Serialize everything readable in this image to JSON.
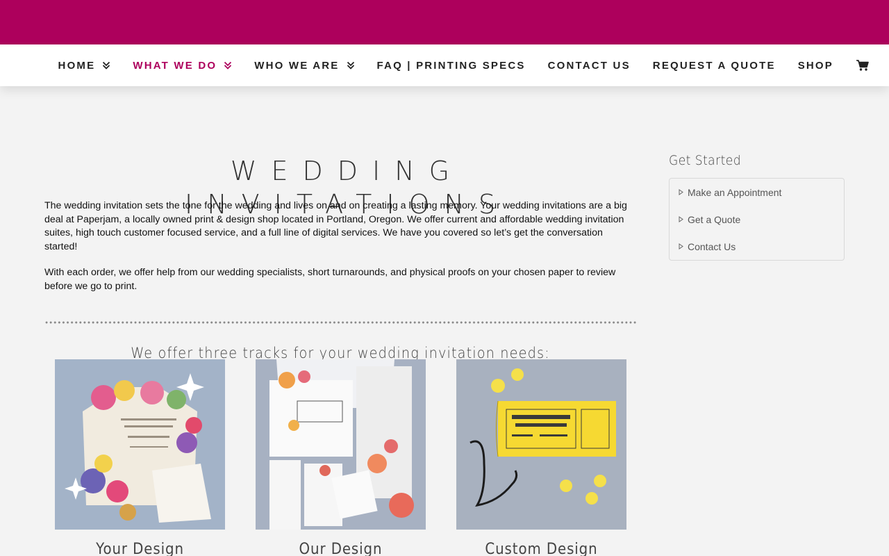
{
  "nav": {
    "items": [
      {
        "label": "HOME",
        "dropdown": true,
        "active": false
      },
      {
        "label": "WHAT WE DO",
        "dropdown": true,
        "active": true
      },
      {
        "label": "WHO WE ARE",
        "dropdown": true,
        "active": false
      },
      {
        "label": "FAQ | PRINTING SPECS",
        "dropdown": false,
        "active": false
      },
      {
        "label": "CONTACT US",
        "dropdown": false,
        "active": false
      },
      {
        "label": "REQUEST A QUOTE",
        "dropdown": false,
        "active": false
      },
      {
        "label": "SHOP",
        "dropdown": false,
        "active": false
      }
    ],
    "cart_icon": "shopping-cart-icon"
  },
  "colors": {
    "brand": "#ad005c",
    "background": "#f3f3f3",
    "nav_text": "#222222"
  },
  "page": {
    "title": "WEDDING INVITATIONS",
    "paragraphs": [
      "The wedding invitation sets the tone for the wedding and lives on and on creating a lasting memory. Your wedding invitations are a big deal at Paperjam, a locally owned print & design shop located in Portland, Oregon. We offer current and affordable wedding invitation suites, high touch customer focused service, and a full line of digital services. We have you covered so let’s get the conversation started!",
      "With each order, we offer help from our wedding specialists, short turnarounds, and physical proofs on your chosen paper to review before we go to print."
    ],
    "tracks_heading": "We offer three tracks for your wedding invitation needs:",
    "tracks": [
      {
        "caption": "Your Design"
      },
      {
        "caption": "Our Design"
      },
      {
        "caption": "Custom Design"
      }
    ]
  },
  "sidebar": {
    "title": "Get Started",
    "links": [
      "Make an Appointment",
      "Get a Quote",
      "Contact Us"
    ]
  }
}
